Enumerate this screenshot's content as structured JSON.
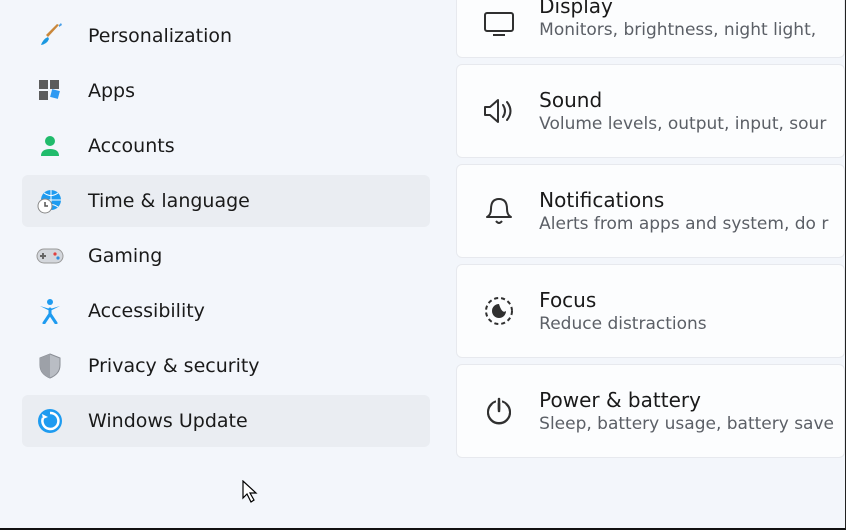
{
  "sidebar": {
    "items": [
      {
        "key": "personalization",
        "label": "Personalization"
      },
      {
        "key": "apps",
        "label": "Apps"
      },
      {
        "key": "accounts",
        "label": "Accounts"
      },
      {
        "key": "time-language",
        "label": "Time & language"
      },
      {
        "key": "gaming",
        "label": "Gaming"
      },
      {
        "key": "accessibility",
        "label": "Accessibility"
      },
      {
        "key": "privacy-security",
        "label": "Privacy & security"
      },
      {
        "key": "windows-update",
        "label": "Windows Update"
      }
    ],
    "hovered": [
      "time-language",
      "windows-update"
    ]
  },
  "content": {
    "cards": [
      {
        "key": "display",
        "title": "Display",
        "sub": "Monitors, brightness, night light,"
      },
      {
        "key": "sound",
        "title": "Sound",
        "sub": "Volume levels, output, input, sour"
      },
      {
        "key": "notifications",
        "title": "Notifications",
        "sub": "Alerts from apps and system, do r"
      },
      {
        "key": "focus",
        "title": "Focus",
        "sub": "Reduce distractions"
      },
      {
        "key": "power-battery",
        "title": "Power & battery",
        "sub": "Sleep, battery usage, battery save"
      }
    ]
  }
}
